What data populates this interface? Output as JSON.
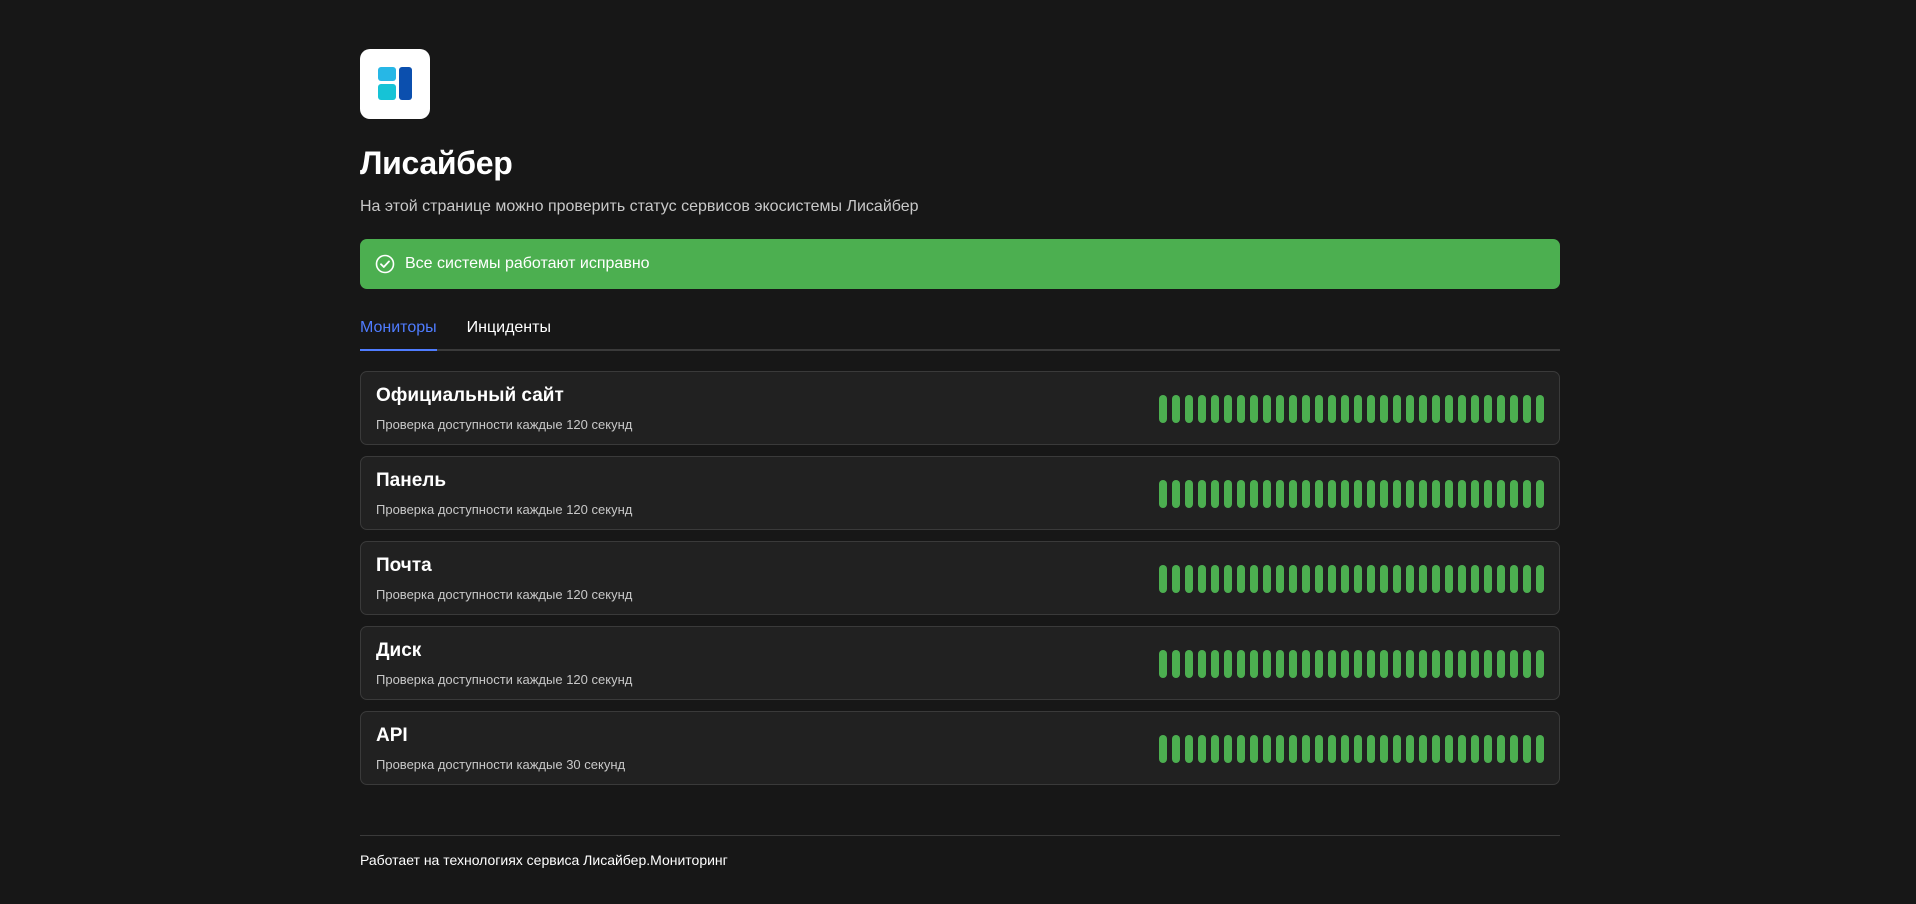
{
  "brand": {
    "logo_icon": "lisaiber-logo-icon",
    "title": "Лисайбер",
    "subtitle": "На этой странице можно проверить статус сервисов экосистемы Лисайбер"
  },
  "status_banner": {
    "icon": "check-circle-icon",
    "text": "Все системы работают исправно",
    "color": "#4caf50"
  },
  "tabs": [
    {
      "label": "Мониторы",
      "active": true
    },
    {
      "label": "Инциденты",
      "active": false
    }
  ],
  "accent_color": "#4f7cff",
  "monitors": [
    {
      "name": "Официальный сайт",
      "description": "Проверка доступности каждые 120 секунд",
      "status": "up"
    },
    {
      "name": "Панель",
      "description": "Проверка доступности каждые 120 секунд",
      "status": "up"
    },
    {
      "name": "Почта",
      "description": "Проверка доступности каждые 120 секунд",
      "status": "up"
    },
    {
      "name": "Диск",
      "description": "Проверка доступности каждые 120 секунд",
      "status": "up"
    },
    {
      "name": "API",
      "description": "Проверка доступности каждые 30 секунд",
      "status": "up"
    }
  ],
  "footer": {
    "text": "Работает на технологиях сервиса Лисайбер.Мониторинг"
  }
}
